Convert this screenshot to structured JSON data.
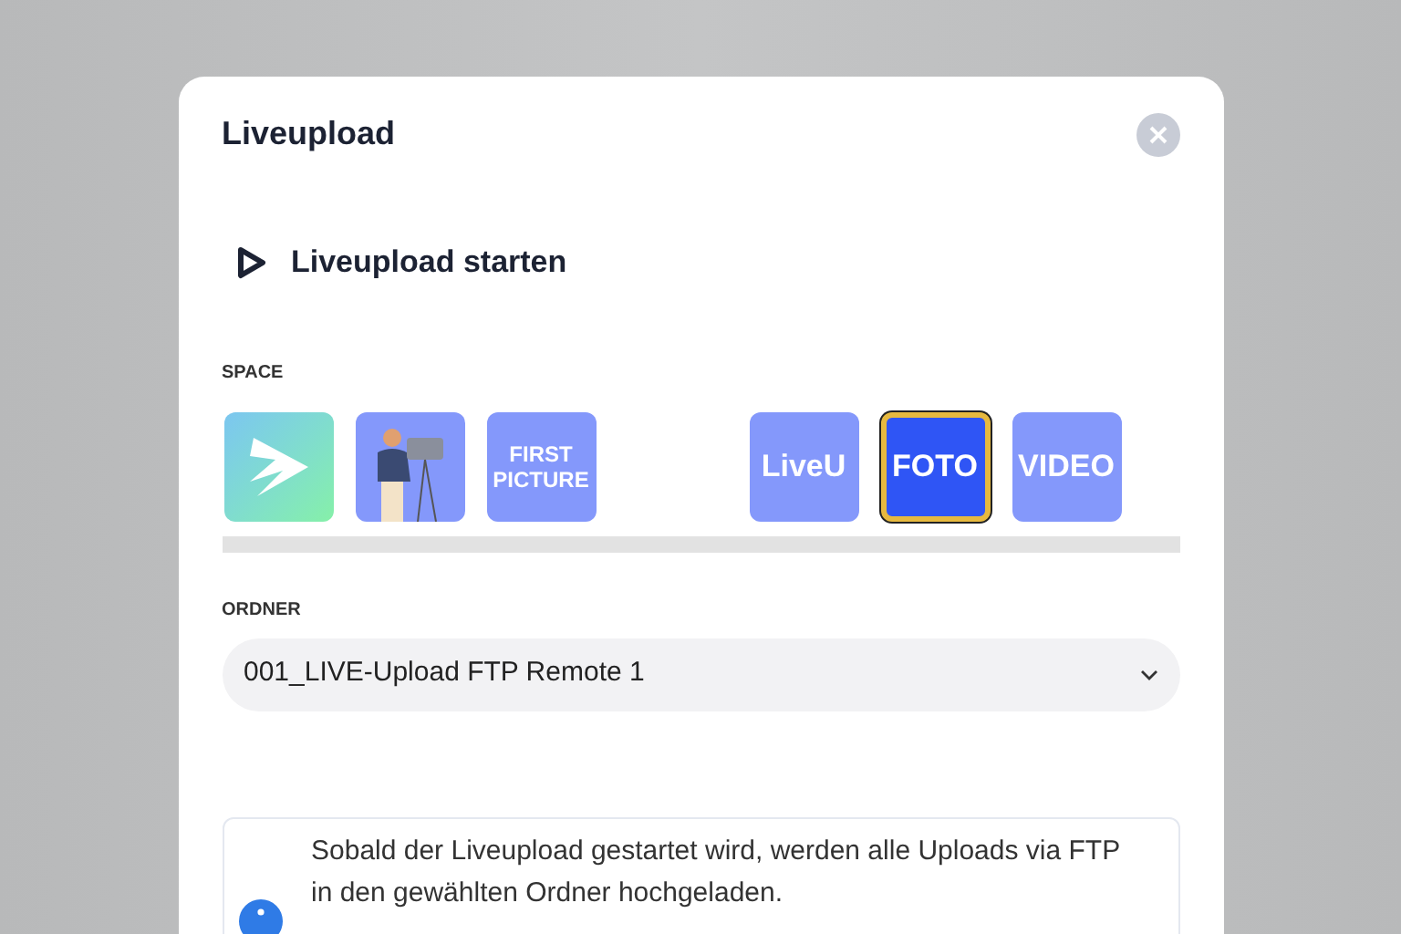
{
  "dialog": {
    "title": "Liveupload"
  },
  "start_action": {
    "label": "Liveupload starten"
  },
  "space": {
    "label": "SPACE",
    "tiles": [
      {
        "kind": "logo",
        "selected": false
      },
      {
        "kind": "illustration",
        "selected": false
      },
      {
        "kind": "text",
        "label": "FIRST PICTURE",
        "selected": false
      },
      {
        "kind": "blank"
      },
      {
        "kind": "text",
        "label": "LiveU",
        "selected": false
      },
      {
        "kind": "text",
        "label": "FOTO",
        "selected": true
      },
      {
        "kind": "text",
        "label": "VIDEO",
        "selected": false
      }
    ]
  },
  "folder": {
    "label": "ORDNER",
    "value": "001_LIVE-Upload FTP Remote 1"
  },
  "info": {
    "text": "Sobald der Liveupload gestartet wird, werden alle Uploads via FTP in den gewählten Ordner hochgeladen."
  }
}
